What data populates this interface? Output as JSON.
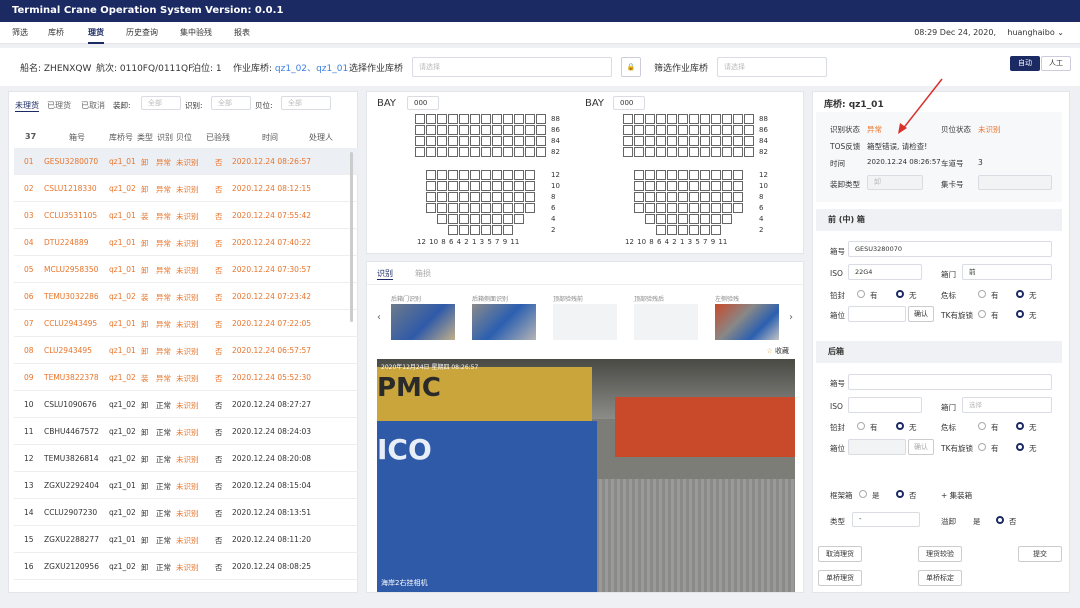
{
  "app": {
    "title": "Terminal Crane Operation System Version: 0.0.1"
  },
  "nav": {
    "items": [
      "筛选",
      "库桥",
      "理货",
      "历史查询",
      "集中验残",
      "报表"
    ],
    "active_index": 2,
    "datetime": "08:29 Dec 24, 2020,",
    "user": "huanghaibo"
  },
  "info": {
    "ship": "船名: ZHENXQW",
    "voyage": "航次: 0110FQ/0111QF",
    "berth": "泊位: 1",
    "crane_label": "作业库桥:",
    "crane_a": "qz1_02",
    "crane_sep": "、",
    "crane_b": "qz1_01",
    "select_crane_label": "选择作业库桥",
    "select_placeholder": "请选择",
    "filter_crane_label": "筛选作业库桥",
    "filter_placeholder": "请选择",
    "auto_label": "自动",
    "manual_label": "人工"
  },
  "list": {
    "tabs": [
      "未理货",
      "已理货",
      "已取消"
    ],
    "filters": {
      "load_label": "装卸:",
      "load_value": "全部",
      "recog_label": "识别:",
      "recog_value": "全部",
      "bay_label": "贝位:",
      "bay_value": "全部"
    },
    "headers": {
      "count": "37",
      "box": "箱号",
      "crane": "库桥号",
      "type": "类型",
      "recog": "识别",
      "bay": "贝位",
      "checked": "已验残",
      "time": "时间",
      "handler": "处理人"
    },
    "rows": [
      {
        "idx": "01",
        "box": "GESU3280070",
        "crane": "qz1_01",
        "type": "卸",
        "recog": "异常",
        "bay": "未识别",
        "checked": "否",
        "time": "2020.12.24 08:26:57",
        "warn": true
      },
      {
        "idx": "02",
        "box": "CSLU1218330",
        "crane": "qz1_02",
        "type": "卸",
        "recog": "异常",
        "bay": "未识别",
        "checked": "否",
        "time": "2020.12.24 08:12:15",
        "warn": true
      },
      {
        "idx": "03",
        "box": "CCLU3531105",
        "crane": "qz1_01",
        "type": "装",
        "recog": "异常",
        "bay": "未识别",
        "checked": "否",
        "time": "2020.12.24 07:55:42",
        "warn": true
      },
      {
        "idx": "04",
        "box": "DTU224889",
        "crane": "qz1_01",
        "type": "卸",
        "recog": "异常",
        "bay": "未识别",
        "checked": "否",
        "time": "2020.12.24 07:40:22",
        "warn": true
      },
      {
        "idx": "05",
        "box": "MCLU2958350",
        "crane": "qz1_01",
        "type": "卸",
        "recog": "异常",
        "bay": "未识别",
        "checked": "否",
        "time": "2020.12.24 07:30:57",
        "warn": true
      },
      {
        "idx": "06",
        "box": "TEMU3032286",
        "crane": "qz1_02",
        "type": "装",
        "recog": "异常",
        "bay": "未识别",
        "checked": "否",
        "time": "2020.12.24 07:23:42",
        "warn": true
      },
      {
        "idx": "07",
        "box": "CCLU2943495",
        "crane": "qz1_01",
        "type": "卸",
        "recog": "异常",
        "bay": "未识别",
        "checked": "否",
        "time": "2020.12.24 07:22:05",
        "warn": true
      },
      {
        "idx": "08",
        "box": "CLU2943495",
        "crane": "qz1_01",
        "type": "卸",
        "recog": "异常",
        "bay": "未识别",
        "checked": "否",
        "time": "2020.12.24 06:57:57",
        "warn": true
      },
      {
        "idx": "09",
        "box": "TEMU3822378",
        "crane": "qz1_02",
        "type": "装",
        "recog": "异常",
        "bay": "未识别",
        "checked": "否",
        "time": "2020.12.24 05:52:30",
        "warn": true
      },
      {
        "idx": "10",
        "box": "CSLU1090676",
        "crane": "qz1_02",
        "type": "卸",
        "recog": "正常",
        "bay": "未识别",
        "checked": "否",
        "time": "2020.12.24 08:27:27",
        "warn": false
      },
      {
        "idx": "11",
        "box": "CBHU4467572",
        "crane": "qz1_02",
        "type": "卸",
        "recog": "正常",
        "bay": "未识别",
        "checked": "否",
        "time": "2020.12.24 08:24:03",
        "warn": false
      },
      {
        "idx": "12",
        "box": "TEMU3826814",
        "crane": "qz1_02",
        "type": "卸",
        "recog": "正常",
        "bay": "未识别",
        "checked": "否",
        "time": "2020.12.24 08:20:08",
        "warn": false
      },
      {
        "idx": "13",
        "box": "ZGXU2292404",
        "crane": "qz1_01",
        "type": "卸",
        "recog": "正常",
        "bay": "未识别",
        "checked": "否",
        "time": "2020.12.24 08:15:04",
        "warn": false
      },
      {
        "idx": "14",
        "box": "CCLU2907230",
        "crane": "qz1_02",
        "type": "卸",
        "recog": "正常",
        "bay": "未识别",
        "checked": "否",
        "time": "2020.12.24 08:13:51",
        "warn": false
      },
      {
        "idx": "15",
        "box": "ZGXU2288277",
        "crane": "qz1_01",
        "type": "卸",
        "recog": "正常",
        "bay": "未识别",
        "checked": "否",
        "time": "2020.12.24 08:11:20",
        "warn": false
      },
      {
        "idx": "16",
        "box": "ZGXU2120956",
        "crane": "qz1_02",
        "type": "卸",
        "recog": "正常",
        "bay": "未识别",
        "checked": "否",
        "time": "2020.12.24 08:08:25",
        "warn": false
      }
    ]
  },
  "bay": {
    "title": "BAY",
    "select_value": "000",
    "upper_labels": [
      "88",
      "86",
      "84",
      "82"
    ],
    "lower_labels": [
      "12",
      "10",
      "8",
      "6",
      "4",
      "2"
    ],
    "bottom_labels": "12 10 8  6  4  2  1  3  5  7  9  11"
  },
  "camera": {
    "tabs": [
      "识别",
      "箱损"
    ],
    "thumbs": [
      "后箱门识别",
      "后箱侧面识别",
      "顶部验残前",
      "顶部验残后",
      "左侧验残"
    ],
    "favorite": "收藏",
    "overlay_time": "2020年12月24日 星期四 08:26:57",
    "overlay_caption": "海岸2右挂相机"
  },
  "detail": {
    "title": "库桥: qz1_01",
    "recog_state_label": "识别状态",
    "recog_state_value": "异常",
    "bay_state_label": "贝位状态",
    "bay_state_value": "未识别",
    "tos_label": "TOS反馈",
    "tos_value": "箱型错误, 请检查!",
    "time_label": "时间",
    "time_value": "2020.12.24 08:26:57",
    "lane_label": "车道号",
    "lane_value": "3",
    "load_type_label": "装卸类型",
    "load_type_value": "卸",
    "truck_label": "集卡号",
    "front_title": "前 (中) 箱",
    "box_label": "箱号",
    "box_value": "GESU3280070",
    "iso_label": "ISO",
    "iso_value": "22G4",
    "door_label": "箱门",
    "door_value": "前",
    "seal_label": "铅封",
    "yes": "有",
    "no": "无",
    "danger_label": "危标",
    "slot_label": "箱位",
    "confirm": "确认",
    "tk_label": "TK有旋锁",
    "rear_title": "后箱",
    "rear_door_placeholder": "选择",
    "dirty_label": "框架箱",
    "shi": "是",
    "fou": "否",
    "add_box": "+ 集装箱",
    "kind_label": "类型",
    "kind_value": "-",
    "overflow_label": "溢卸",
    "btn_cancel": "取消理货",
    "btn_damage": "理货较验",
    "btn_submit": "提交",
    "btn_single": "单桥理货",
    "btn_bind": "单桥标定"
  },
  "colors": {
    "primary": "#1b2a63",
    "warn": "#e8742a",
    "link": "#3d7fe0"
  }
}
